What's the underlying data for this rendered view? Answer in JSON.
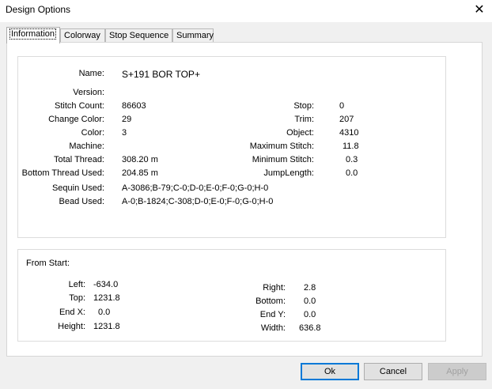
{
  "window": {
    "title": "Design Options",
    "close_glyph": "✕"
  },
  "tabs": [
    "Information",
    "Colorway",
    "Stop Sequence",
    "Summary"
  ],
  "info": {
    "name": {
      "label": "Name:",
      "value": "S+191 BOR TOP+"
    },
    "version": {
      "label": "Version:",
      "value": ""
    },
    "stitch_count": {
      "label": "Stitch Count:",
      "value": "86603"
    },
    "change_color": {
      "label": "Change Color:",
      "value": "29"
    },
    "color": {
      "label": "Color:",
      "value": "3"
    },
    "machine": {
      "label": "Machine:",
      "value": ""
    },
    "total_thread": {
      "label": "Total Thread:",
      "value": "308.20 m"
    },
    "bottom_thread": {
      "label": "Bottom Thread Used:",
      "value": "204.85 m"
    },
    "sequin_used": {
      "label": "Sequin Used:",
      "value": "A-3086;B-79;C-0;D-0;E-0;F-0;G-0;H-0"
    },
    "bead_used": {
      "label": "Bead Used:",
      "value": "A-0;B-1824;C-308;D-0;E-0;F-0;G-0;H-0"
    },
    "stop": {
      "label": "Stop:",
      "value": "0"
    },
    "trim": {
      "label": "Trim:",
      "value": "207"
    },
    "object": {
      "label": "Object:",
      "value": "4310"
    },
    "max_stitch": {
      "label": "Maximum Stitch:",
      "value": "11.8"
    },
    "min_stitch": {
      "label": "Minimum Stitch:",
      "value": "0.3"
    },
    "jump_length": {
      "label": "JumpLength:",
      "value": "0.0"
    }
  },
  "from_start": {
    "heading": "From Start:",
    "left": {
      "label": "Left:",
      "value": "-634.0"
    },
    "top": {
      "label": "Top:",
      "value": "1231.8"
    },
    "end_x": {
      "label": "End X:",
      "value": "0.0"
    },
    "height": {
      "label": "Height:",
      "value": "1231.8"
    },
    "right": {
      "label": "Right:",
      "value": "2.8"
    },
    "bottom": {
      "label": "Bottom:",
      "value": "0.0"
    },
    "end_y": {
      "label": "End Y:",
      "value": "0.0"
    },
    "width": {
      "label": "Width:",
      "value": "636.8"
    }
  },
  "buttons": {
    "ok": "Ok",
    "cancel": "Cancel",
    "apply": "Apply"
  }
}
